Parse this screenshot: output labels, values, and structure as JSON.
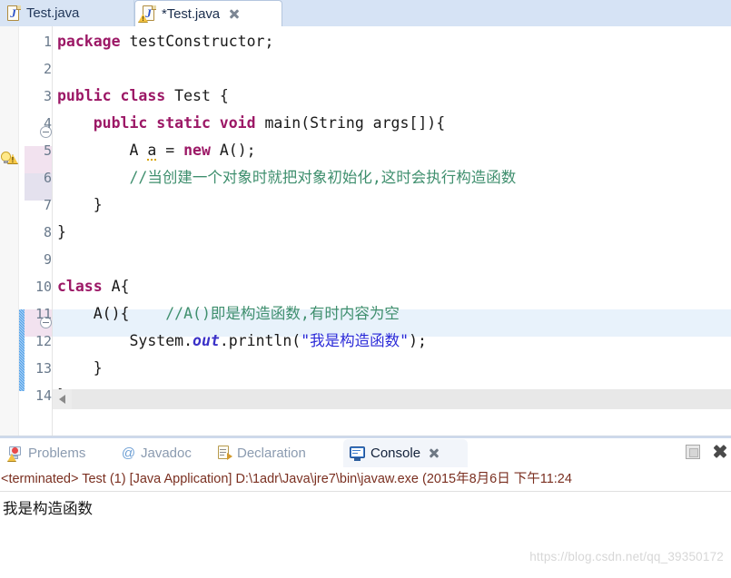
{
  "editor": {
    "tabs": [
      {
        "label": "Test.java",
        "icon": "java-file-icon",
        "active": false,
        "dirty": false,
        "closable": false
      },
      {
        "label": "*Test.java",
        "icon": "java-file-warning-icon",
        "active": true,
        "dirty": true,
        "closable": true
      }
    ],
    "lines": [
      {
        "num": "1",
        "fold": false,
        "marker": "",
        "highlight": "none",
        "changed": false
      },
      {
        "num": "2",
        "fold": false,
        "marker": "",
        "highlight": "none",
        "changed": false
      },
      {
        "num": "3",
        "fold": false,
        "marker": "",
        "highlight": "none",
        "changed": false
      },
      {
        "num": "4",
        "fold": true,
        "marker": "",
        "highlight": "none",
        "changed": false
      },
      {
        "num": "5",
        "fold": false,
        "marker": "warning-lamp",
        "highlight": "pink",
        "changed": false
      },
      {
        "num": "6",
        "fold": false,
        "marker": "",
        "highlight": "lavender",
        "changed": false
      },
      {
        "num": "7",
        "fold": false,
        "marker": "",
        "highlight": "none",
        "changed": false
      },
      {
        "num": "8",
        "fold": false,
        "marker": "",
        "highlight": "none",
        "changed": false
      },
      {
        "num": "9",
        "fold": false,
        "marker": "",
        "highlight": "none",
        "changed": false
      },
      {
        "num": "10",
        "fold": false,
        "marker": "",
        "highlight": "none",
        "changed": false
      },
      {
        "num": "11",
        "fold": true,
        "marker": "",
        "highlight": "pink",
        "changed": true
      },
      {
        "num": "12",
        "fold": false,
        "marker": "",
        "highlight": "none",
        "changed": true
      },
      {
        "num": "13",
        "fold": false,
        "marker": "",
        "highlight": "none",
        "changed": true
      },
      {
        "num": "14",
        "fold": false,
        "marker": "",
        "highlight": "none",
        "changed": false
      }
    ],
    "code": {
      "l1_kw": "package",
      "l1_name": " testConstructor;",
      "l3_kw1": "public",
      "l3_kw2": " class",
      "l3_name": " Test {",
      "l4_kw": "    public static void",
      "l4_rest": " main(String args[]){",
      "l5_type": "        A ",
      "l5_var": "a",
      "l5_eq": " = ",
      "l5_new": "new",
      "l5_rest": " A();",
      "l6_cmt": "        //当创建一个对象时就把对象初始化,这时会执行构造函数",
      "l7": "    }",
      "l8": "}",
      "l10_kw": "class",
      "l10_rest": " A{",
      "l11_code": "    A(){    ",
      "l11_cmt": "//A()即是构造函数,有时内容为空",
      "l12_a": "        System.",
      "l12_out": "out",
      "l12_b": ".println(",
      "l12_str": "\"我是构造函数\"",
      "l12_c": ");",
      "l13": "    }",
      "l14": "}"
    }
  },
  "bottom_panel": {
    "tabs": [
      {
        "label": "Problems",
        "icon": "problems-icon",
        "active": false,
        "closable": false
      },
      {
        "label": "Javadoc",
        "icon": "javadoc-at-icon",
        "active": false,
        "closable": false
      },
      {
        "label": "Declaration",
        "icon": "declaration-icon",
        "active": false,
        "closable": false
      },
      {
        "label": "Console",
        "icon": "console-icon",
        "active": true,
        "closable": true
      }
    ],
    "actions": [
      {
        "name": "terminate-button",
        "label": ""
      },
      {
        "name": "close-panel-button",
        "label": ""
      }
    ],
    "terminated_line": "<terminated> Test (1) [Java Application] D:\\1adr\\Java\\jre7\\bin\\javaw.exe (2015年8月6日 下午11:24",
    "console_output": "我是构造函数"
  },
  "watermark": "https://blog.csdn.net/qq_39350172",
  "colors": {
    "tabbar_bg": "#d6e3f5",
    "keyword": "#9c1866",
    "comment": "#3f8f6e",
    "string": "#2a2ad8",
    "static_field": "#3b32c8",
    "current_line": "#e8f2fb",
    "change_bar": "#4f9fe8",
    "terminated_text": "#7a2f20"
  }
}
